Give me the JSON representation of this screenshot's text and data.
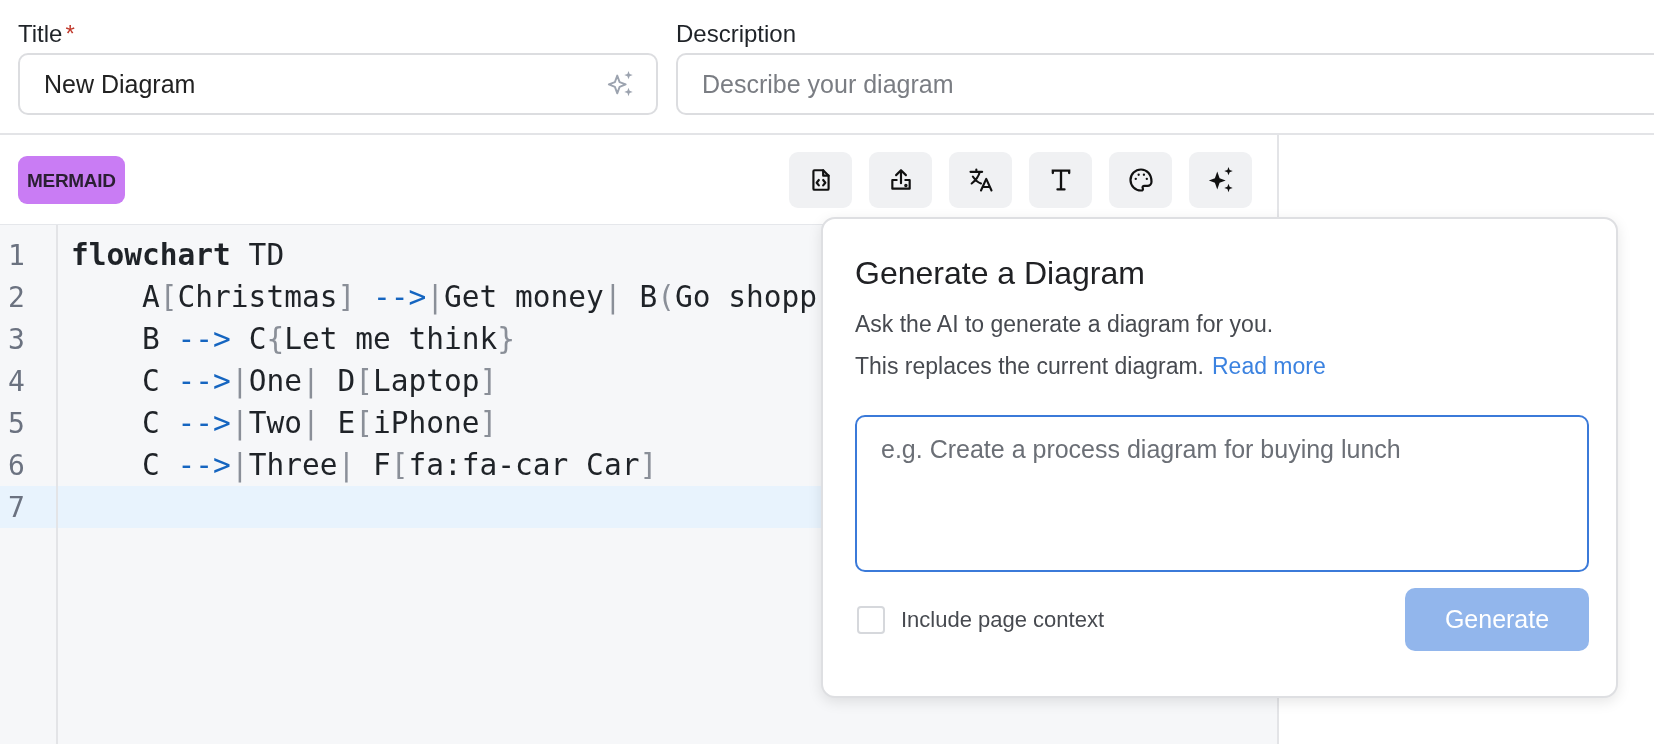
{
  "form": {
    "title": {
      "label": "Title",
      "required_mark": "*",
      "value": "New Diagram"
    },
    "description": {
      "label": "Description",
      "placeholder": "Describe your diagram"
    }
  },
  "editor": {
    "language_badge": "MERMAID",
    "toolbar": [
      {
        "kind": "code"
      },
      {
        "kind": "upload"
      },
      {
        "kind": "translate"
      },
      {
        "kind": "text"
      },
      {
        "kind": "palette"
      },
      {
        "kind": "sparkles"
      }
    ],
    "lines": [
      {
        "number": "1",
        "active": false,
        "tokens": [
          {
            "kind": "keyword",
            "text": "flowchart"
          },
          {
            "kind": "plain",
            "text": " TD"
          }
        ]
      },
      {
        "number": "2",
        "active": false,
        "tokens": [
          {
            "kind": "plain",
            "text": "    A"
          },
          {
            "kind": "bracket",
            "text": "["
          },
          {
            "kind": "plain",
            "text": "Christmas"
          },
          {
            "kind": "bracket",
            "text": "]"
          },
          {
            "kind": "arrow",
            "text": " -->"
          },
          {
            "kind": "bracket",
            "text": "|"
          },
          {
            "kind": "plain",
            "text": "Get money"
          },
          {
            "kind": "bracket",
            "text": "|"
          },
          {
            "kind": "plain",
            "text": " B"
          },
          {
            "kind": "bracket",
            "text": "("
          },
          {
            "kind": "plain",
            "text": "Go shopp"
          }
        ]
      },
      {
        "number": "3",
        "active": false,
        "tokens": [
          {
            "kind": "plain",
            "text": "    B "
          },
          {
            "kind": "arrow",
            "text": "-->"
          },
          {
            "kind": "plain",
            "text": " C"
          },
          {
            "kind": "bracket",
            "text": "{"
          },
          {
            "kind": "plain",
            "text": "Let me think"
          },
          {
            "kind": "bracket",
            "text": "}"
          }
        ]
      },
      {
        "number": "4",
        "active": false,
        "tokens": [
          {
            "kind": "plain",
            "text": "    C "
          },
          {
            "kind": "arrow",
            "text": "-->"
          },
          {
            "kind": "bracket",
            "text": "|"
          },
          {
            "kind": "plain",
            "text": "One"
          },
          {
            "kind": "bracket",
            "text": "|"
          },
          {
            "kind": "plain",
            "text": " D"
          },
          {
            "kind": "bracket",
            "text": "["
          },
          {
            "kind": "plain",
            "text": "Laptop"
          },
          {
            "kind": "bracket",
            "text": "]"
          }
        ]
      },
      {
        "number": "5",
        "active": false,
        "tokens": [
          {
            "kind": "plain",
            "text": "    C "
          },
          {
            "kind": "arrow",
            "text": "-->"
          },
          {
            "kind": "bracket",
            "text": "|"
          },
          {
            "kind": "plain",
            "text": "Two"
          },
          {
            "kind": "bracket",
            "text": "|"
          },
          {
            "kind": "plain",
            "text": " E"
          },
          {
            "kind": "bracket",
            "text": "["
          },
          {
            "kind": "plain",
            "text": "iPhone"
          },
          {
            "kind": "bracket",
            "text": "]"
          }
        ]
      },
      {
        "number": "6",
        "active": false,
        "tokens": [
          {
            "kind": "plain",
            "text": "    C "
          },
          {
            "kind": "arrow",
            "text": "-->"
          },
          {
            "kind": "bracket",
            "text": "|"
          },
          {
            "kind": "plain",
            "text": "Three"
          },
          {
            "kind": "bracket",
            "text": "|"
          },
          {
            "kind": "plain",
            "text": " F"
          },
          {
            "kind": "bracket",
            "text": "["
          },
          {
            "kind": "plain",
            "text": "fa:fa-car Car"
          },
          {
            "kind": "bracket",
            "text": "]"
          }
        ]
      },
      {
        "number": "7",
        "active": true
      }
    ]
  },
  "popover": {
    "title": "Generate a Diagram",
    "line_1": "Ask the AI to generate a diagram for you.",
    "line_2": "This replaces the current diagram.",
    "link": "Read more",
    "prompt": {
      "placeholder": "e.g. Create a process diagram for buying lunch",
      "focused": true
    },
    "context": {
      "label": "Include page context",
      "checked": false
    },
    "generate": {
      "label": "Generate",
      "disabled": true
    }
  }
}
